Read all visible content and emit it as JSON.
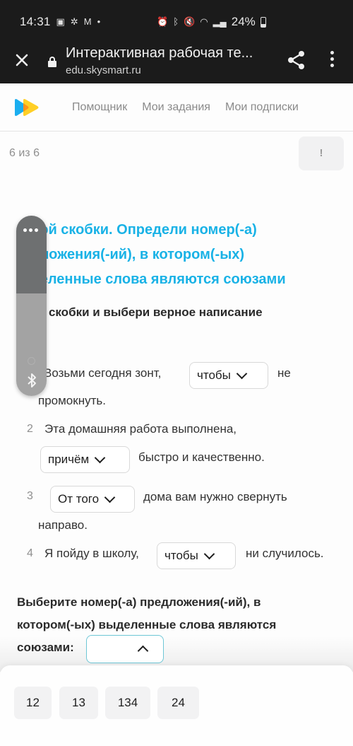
{
  "status_bar": {
    "time": "14:31",
    "left_icons": [
      "gallery-icon",
      "fan-icon",
      "gmail-icon",
      "dot-icon"
    ],
    "right_icons": [
      "alarm-icon",
      "bluetooth-icon",
      "mute-vibrate-icon",
      "wifi-icon",
      "signal-icon"
    ],
    "battery_percent": "24%"
  },
  "browser": {
    "title": "Интерактивная рабочая те...",
    "url": "edu.skysmart.ru",
    "close_glyph": "✕"
  },
  "header": {
    "nav": [
      "Помощник",
      "Мои задания",
      "Мои подписки"
    ]
  },
  "progress": {
    "label": "6 из 6",
    "report_glyph": "!"
  },
  "task": {
    "title": "Раскрой скобки. Определи номер(-а) предложения(-ий), в котором(-ых) выделенные слова являются союзами",
    "title_visible": "крой скобки. Определи номер(-а) дложения(-ий), в котором(-ых) деленные слова являются союзами",
    "title_lines": [
      "крой скобки. Определи номер(-а)",
      "дложения(-ий), в котором(-ых)",
      "деленные слова являются союзами"
    ],
    "subtitle_lines": [
      "рой скобки и выбери верное написание",
      ":"
    ]
  },
  "sentences": [
    {
      "num": "1",
      "before": "Возьми сегодня зонт,",
      "selected": "чтобы",
      "after": "не",
      "after2": "промокнуть."
    },
    {
      "num": "2",
      "before": "Эта домашняя работа выполнена,",
      "selected": "причём",
      "after": "быстро и качественно."
    },
    {
      "num": "3",
      "before": "",
      "selected": "От того",
      "after": "дома вам нужно свернуть",
      "after2": "направо."
    },
    {
      "num": "4",
      "before": "Я пойду в школу,",
      "selected": "чтобы",
      "after": "ни случилось."
    }
  ],
  "answer": {
    "question_lines": [
      "Выберите номер(-а) предложения(-ий), в",
      "котором(-ых) выделенные слова являются",
      "союзами:"
    ],
    "selected": "",
    "options": [
      "12",
      "13",
      "134",
      "24"
    ]
  },
  "colors": {
    "accent_blue": "#19b2e6",
    "select_border": "#6ec7d6",
    "logo_blue": "#1aaef0",
    "logo_yellow": "#ffcc1a"
  }
}
